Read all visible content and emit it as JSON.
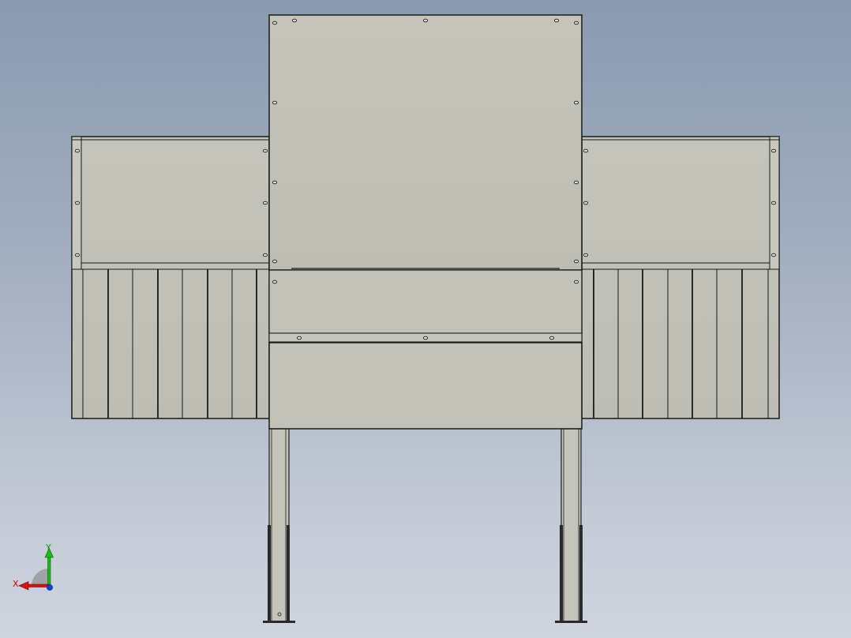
{
  "viewport": {
    "background_top": "#8a9ab0",
    "background_bottom": "#cfd4de"
  },
  "model": {
    "panel_fill": "#c2c2b8",
    "panel_fill_light": "#c8c8be",
    "edge_color": "#1a1a1a",
    "view": "front",
    "parts": [
      "center-cabinet",
      "left-wing-guard",
      "right-wing-guard",
      "left-leg",
      "right-leg",
      "lower-hopper"
    ]
  },
  "triad": {
    "x_label": "X",
    "y_label": "Y",
    "x_color": "#e01010",
    "y_color": "#10c010",
    "z_color": "#1040e0"
  }
}
